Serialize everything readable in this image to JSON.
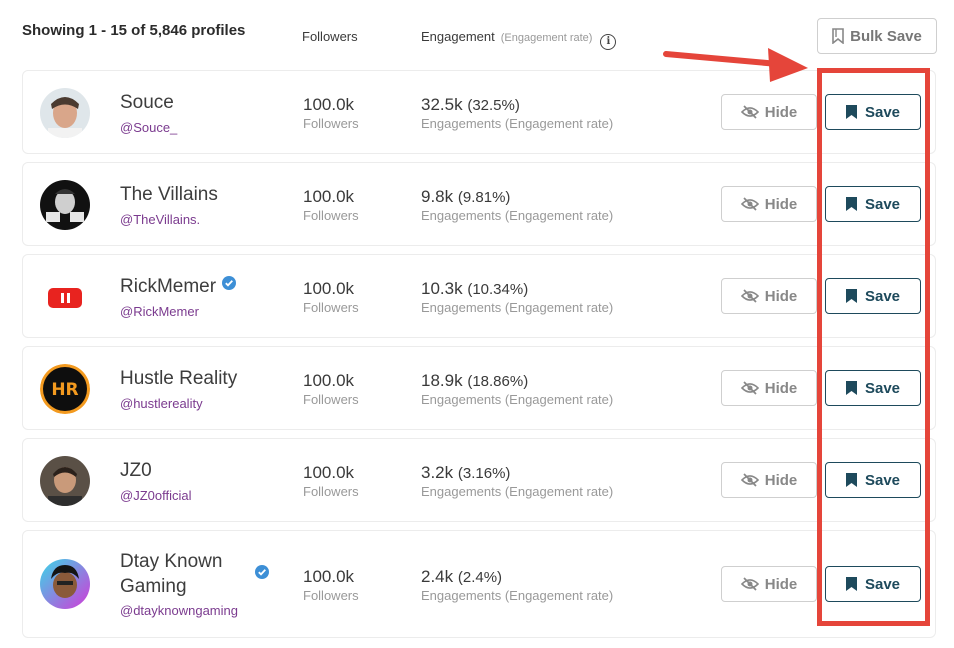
{
  "header": {
    "showing": "Showing 1 - 15 of 5,846 profiles",
    "followers_col": "Followers",
    "engagement_col": "Engagement",
    "engagement_sub": "(Engagement rate)",
    "info_glyph": "i",
    "bulk_save_label": "Bulk Save"
  },
  "labels": {
    "followers": "Followers",
    "engagements": "Engagements (Engagement rate)",
    "hide": "Hide",
    "save": "Save"
  },
  "profiles": [
    {
      "name": "Souce",
      "handle": "@Souce_",
      "followers": "100.0k",
      "engagement": "32.5k",
      "rate": "(32.5%)",
      "verified": false
    },
    {
      "name": "The Villains",
      "handle": "@TheVillains.",
      "followers": "100.0k",
      "engagement": "9.8k",
      "rate": "(9.81%)",
      "verified": false
    },
    {
      "name": "RickMemer",
      "handle": "@RickMemer",
      "followers": "100.0k",
      "engagement": "10.3k",
      "rate": "(10.34%)",
      "verified": true
    },
    {
      "name": "Hustle Reality",
      "handle": "@hustlereality",
      "followers": "100.0k",
      "engagement": "18.9k",
      "rate": "(18.86%)",
      "verified": false
    },
    {
      "name": "JZ0",
      "handle": "@JZ0official",
      "followers": "100.0k",
      "engagement": "3.2k",
      "rate": "(3.16%)",
      "verified": false
    },
    {
      "name": "Dtay Known Gaming",
      "handle": "@dtayknowngaming",
      "followers": "100.0k",
      "engagement": "2.4k",
      "rate": "(2.4%)",
      "verified": true
    }
  ],
  "avatars": {
    "hustle_reality_logo_text": "HR"
  },
  "colors": {
    "accent": "#1e4a5c",
    "handle": "#7b3b8f",
    "highlight": "#e5453a",
    "verified": "#3d8fd6"
  }
}
